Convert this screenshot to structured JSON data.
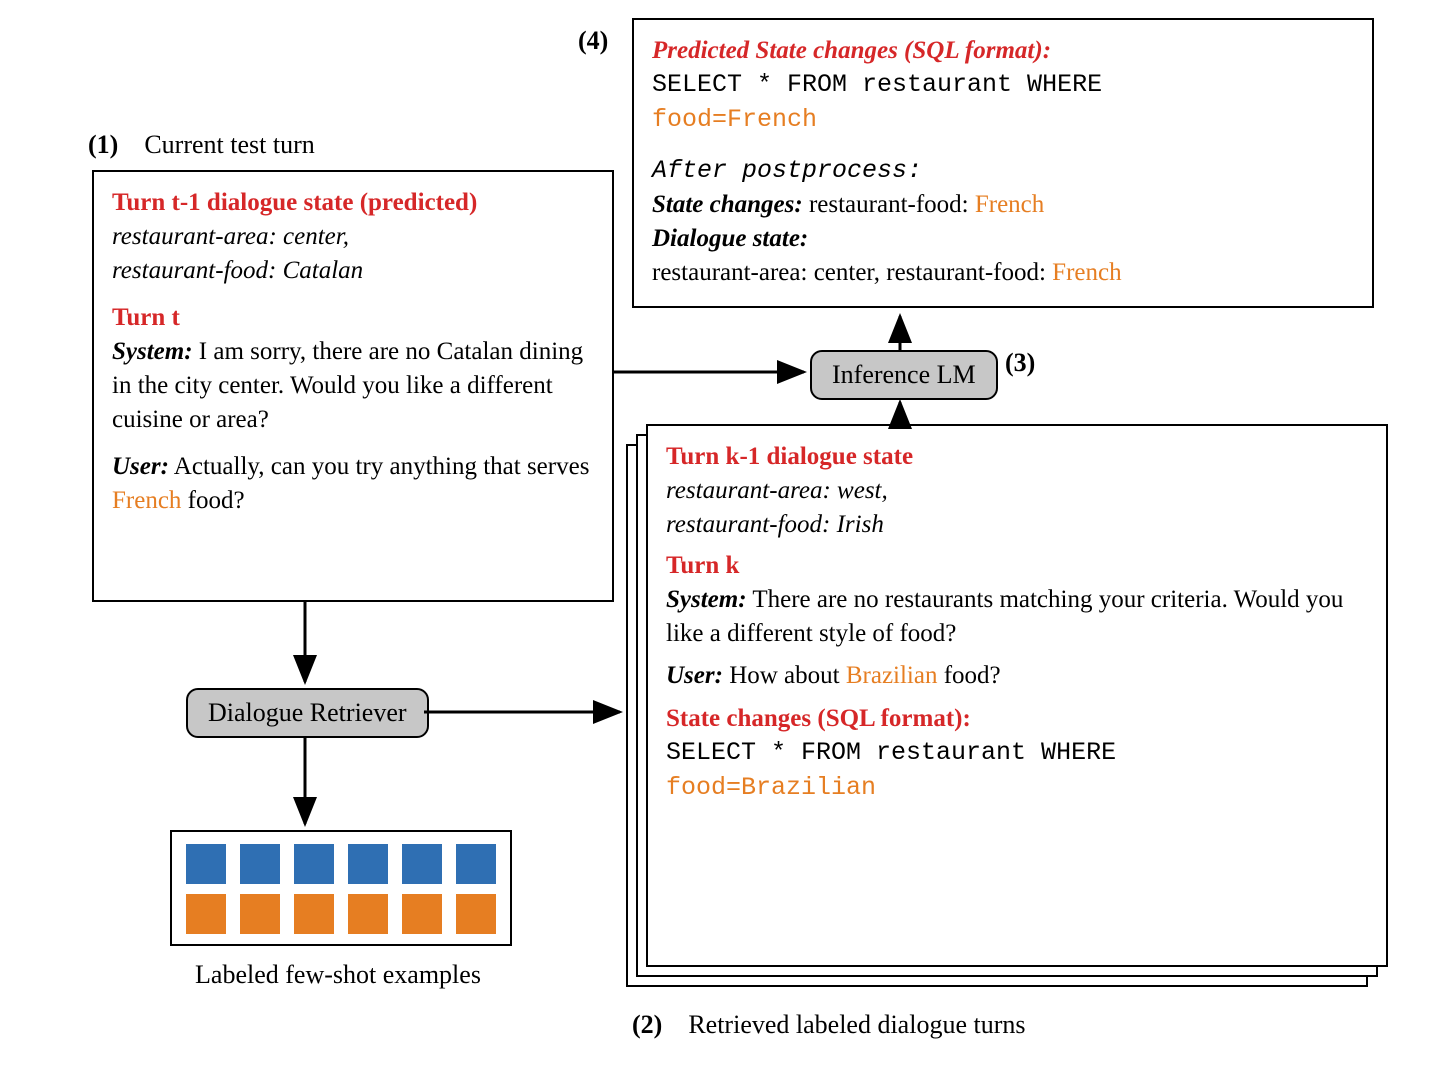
{
  "labels": {
    "n1": "(1)",
    "n1_text": "Current test turn",
    "n2": "(2)",
    "n2_text": "Retrieved labeled dialogue turns",
    "n3": "(3)",
    "n4": "(4)"
  },
  "box1": {
    "heading_prev": "Turn  t-1 dialogue state (predicted)",
    "prev_state1": "restaurant-area: center,",
    "prev_state2": "restaurant-food: Catalan",
    "heading_turn": "Turn  t",
    "sys_label": "System:",
    "sys_text": " I am sorry, there are no Catalan dining in the city center. Would you like a different cuisine or area?",
    "user_label": "User:",
    "user_text_pre": " Actually, can you try anything that serves ",
    "user_hl": "French",
    "user_text_post": " food?"
  },
  "retriever": {
    "label": "Dialogue Retriever"
  },
  "examples_caption": "Labeled few-shot examples",
  "box2": {
    "heading_prev": "Turn  k-1 dialogue state",
    "prev_state1": "restaurant-area: west,",
    "prev_state2": "restaurant-food: Irish",
    "heading_turn": "Turn  k",
    "sys_label": "System:",
    "sys_text": " There are no restaurants matching your criteria. Would you like a different style of food?",
    "user_label": "User:",
    "user_text_pre": " How about ",
    "user_hl": "Brazilian",
    "user_text_post": " food?",
    "sc_heading": "State changes (SQL format):",
    "sql_line1": "SELECT * FROM restaurant WHERE",
    "sql_line2": "food=Brazilian"
  },
  "inference": {
    "label": "Inference LM"
  },
  "box4": {
    "pred_heading": "Predicted State changes (SQL format)",
    "sql_line1": "SELECT * FROM restaurant WHERE",
    "sql_line2": "food=French",
    "postprocess": "After postprocess:",
    "sc_label": "State changes:",
    "sc_text_pre": "   restaurant-food: ",
    "sc_hl": "French",
    "ds_label": "Dialogue state:",
    "ds_text_pre": "restaurant-area: center,  restaurant-food: ",
    "ds_hl": "French"
  }
}
